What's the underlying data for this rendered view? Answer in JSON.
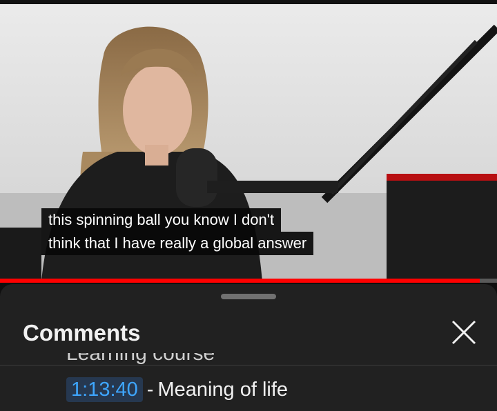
{
  "video": {
    "captions": [
      "this spinning ball you know I don't",
      "think that I have really a global answer"
    ],
    "progress_fraction": 0.965,
    "progress_color": "#ff0000"
  },
  "comments_sheet": {
    "title": "Comments",
    "close_icon": "close-icon",
    "clipped_text": "Learning course",
    "chapter": {
      "timestamp": "1:13:40",
      "separator": "-",
      "title": "Meaning of life"
    }
  }
}
